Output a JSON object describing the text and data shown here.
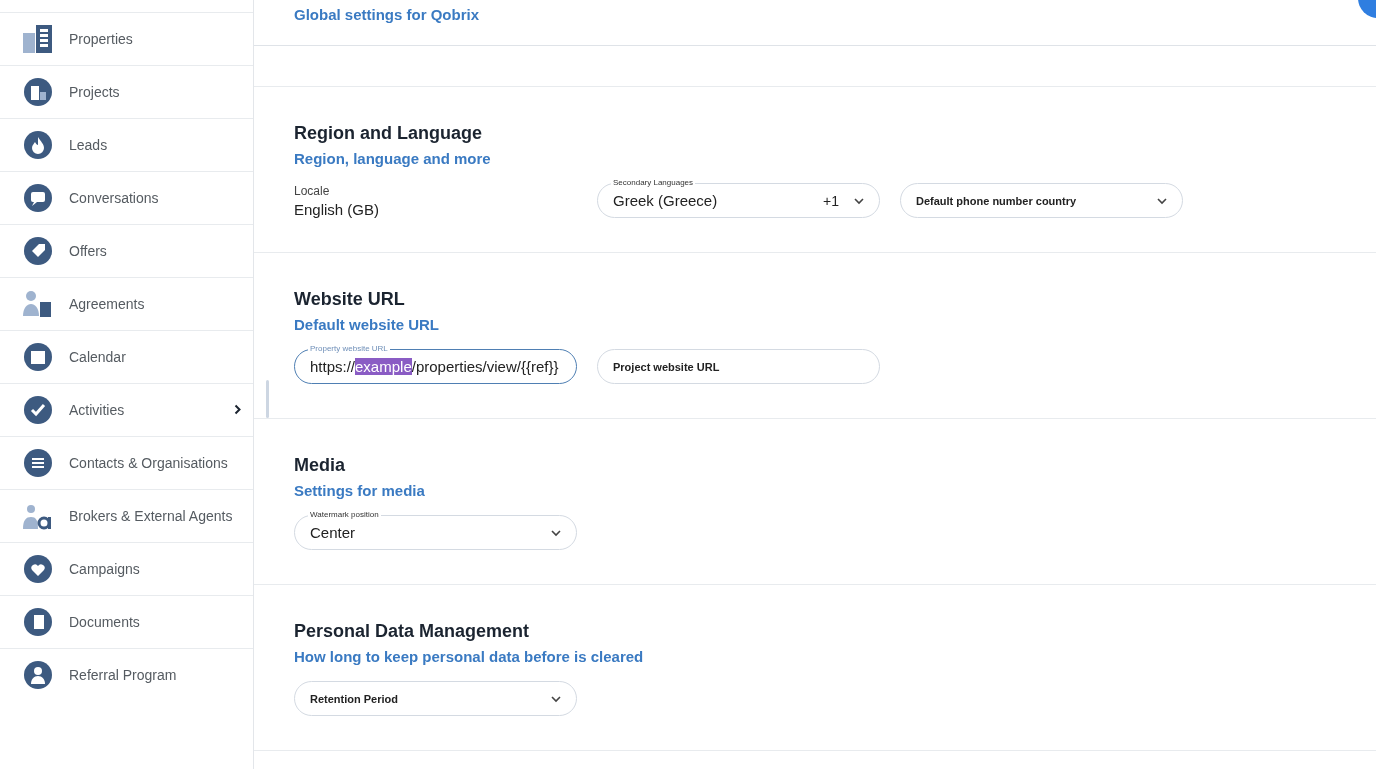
{
  "sidebar": {
    "items": [
      {
        "label": "Properties",
        "expandable": false
      },
      {
        "label": "Projects",
        "expandable": false
      },
      {
        "label": "Leads",
        "expandable": false
      },
      {
        "label": "Conversations",
        "expandable": false
      },
      {
        "label": "Offers",
        "expandable": false
      },
      {
        "label": "Agreements",
        "expandable": false
      },
      {
        "label": "Calendar",
        "expandable": false
      },
      {
        "label": "Activities",
        "expandable": true
      },
      {
        "label": "Contacts & Organisations",
        "expandable": false
      },
      {
        "label": "Brokers & External Agents",
        "expandable": false
      },
      {
        "label": "Campaigns",
        "expandable": false
      },
      {
        "label": "Documents",
        "expandable": false
      },
      {
        "label": "Referral Program",
        "expandable": false
      }
    ]
  },
  "header": {
    "subtitle": "Global settings for Qobrix"
  },
  "sections": [
    {
      "title": "Region and Language",
      "subtitle": "Region, language and more",
      "fields": [
        {
          "kind": "static",
          "label": "Locale",
          "value": "English (GB)"
        },
        {
          "kind": "select",
          "label": "Secondary Languages",
          "value": "Greek (Greece)",
          "count": "+1"
        },
        {
          "kind": "select",
          "placeholder": "Default phone number country"
        }
      ]
    },
    {
      "title": "Website URL",
      "subtitle": "Default website URL",
      "fields": [
        {
          "kind": "input",
          "label": "Property website URL",
          "focused": true,
          "value_parts": [
            {
              "text": "https://",
              "selected": false
            },
            {
              "text": "example",
              "selected": true
            },
            {
              "text": "/properties/view/{{ref}}",
              "selected": false
            }
          ]
        },
        {
          "kind": "input",
          "placeholder": "Project website URL",
          "focused": false
        }
      ]
    },
    {
      "title": "Media",
      "subtitle": "Settings for media",
      "fields": [
        {
          "kind": "select",
          "label": "Watermark position",
          "value": "Center"
        }
      ]
    },
    {
      "title": "Personal Data Management",
      "subtitle": "How long to keep personal data before is cleared",
      "fields": [
        {
          "kind": "select",
          "placeholder": "Retention Period"
        }
      ]
    }
  ]
}
